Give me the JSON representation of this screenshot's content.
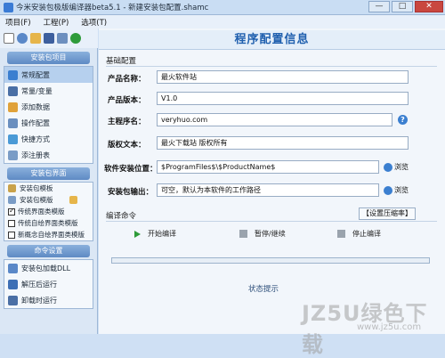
{
  "window": {
    "title": "今米安装包极版编译器beta5.1 - 新建安装包配置.shamc",
    "minimize": "—",
    "maximize": "□",
    "close": "✕"
  },
  "menu": [
    "项目(F)",
    "工程(P)",
    "选项(T)"
  ],
  "sidebar": {
    "group1": {
      "header": "安装包项目",
      "items": [
        {
          "label": "常规配置",
          "icon_color": "#3b7fd0",
          "selected": true
        },
        {
          "label": "常量/变量",
          "icon_color": "#4a6fa5",
          "selected": false
        },
        {
          "label": "添加数据",
          "icon_color": "#e0a23a",
          "selected": false
        },
        {
          "label": "操作配置",
          "icon_color": "#6a8fbf",
          "selected": false
        },
        {
          "label": "快捷方式",
          "icon_color": "#4a9ad6",
          "selected": false
        },
        {
          "label": "添注册表",
          "icon_color": "#7a9cc6",
          "selected": false
        }
      ]
    },
    "group2": {
      "header": "安装包界面",
      "items": [
        {
          "label": "安装包模板"
        },
        {
          "label": "安装包模版"
        }
      ],
      "checks": [
        {
          "label": "传统界面类模版",
          "checked": true
        },
        {
          "label": "传统自绘界面类模版",
          "checked": false
        },
        {
          "label": "新概念自绘界面类模版",
          "checked": false
        }
      ]
    },
    "group3": {
      "header": "命令设置",
      "items": [
        {
          "label": "安装包加载DLL"
        },
        {
          "label": "解压后运行"
        },
        {
          "label": "卸载时运行"
        }
      ]
    }
  },
  "main": {
    "title": "程序配置信息",
    "basic_section": "基础配置",
    "fields": {
      "product_name": {
        "label": "产品名称：",
        "value": "最火软件站"
      },
      "product_version": {
        "label": "产品版本：",
        "value": "V1.0"
      },
      "homepage": {
        "label": "主程序名：",
        "value": "veryhuo.com"
      },
      "copyright": {
        "label": "版权文本：",
        "value": "最火下载站 版权所有"
      },
      "install_path": {
        "label": "软件安装位置：",
        "value": "$ProgramFiles$\\$ProductName$"
      },
      "output": {
        "label": "安装包输出：",
        "value": "可空，默认为本软件的工作路径"
      }
    },
    "browse_label": "浏览",
    "compile_section": "编译命令",
    "settings_button": "【设置压缩率】",
    "actions": {
      "start": "开始编译",
      "pause": "暂停/继续",
      "stop": "停止编译"
    },
    "status": "状态提示"
  },
  "watermark": {
    "text": "JZ5U绿色下载",
    "url": "www.jz5u.com"
  }
}
